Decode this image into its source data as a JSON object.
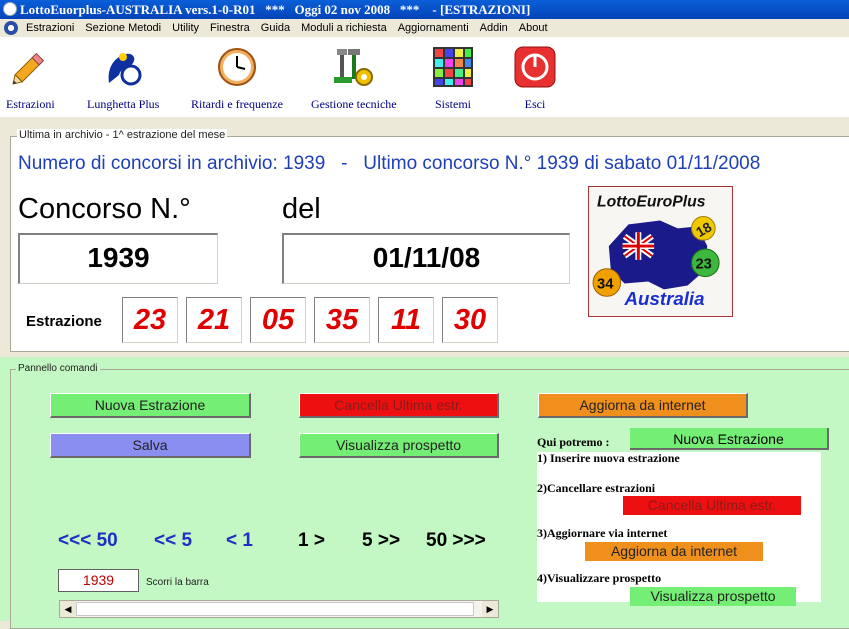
{
  "window": {
    "title": "LottoEuorplus-AUSTRALIA vers.1-0-R01   ***   Oggi 02 nov 2008   ***    - [ESTRAZIONI]"
  },
  "menu": [
    "Estrazioni",
    "Sezione Metodi",
    "Utility",
    "Finestra",
    "Guida",
    "Moduli a richiesta",
    "Aggiornamenti",
    "Addin",
    "About"
  ],
  "toolbar": {
    "estrazioni": "Estrazioni",
    "lunghetta": "Lunghetta Plus",
    "ritardi": "Ritardi e frequenze",
    "tecniche": "Gestione tecniche",
    "sistemi": "Sistemi",
    "esci": "Esci"
  },
  "archive": {
    "legend": "Ultima in archivio - 1^ estrazione del mese",
    "info": "Numero di concorsi in archivio: 1939   -   Ultimo concorso N.° 1939 di sabato 01/11/2008",
    "concorso_label": "Concorso N.°",
    "del_label": "del",
    "concorso_value": "1939",
    "date_value": "01/11/08",
    "estrazione_label": "Estrazione",
    "numbers": [
      "23",
      "21",
      "05",
      "35",
      "11",
      "30"
    ]
  },
  "logo": {
    "line1": "LottoEuroPlus",
    "line2": "Australia",
    "balls": [
      "18",
      "23",
      "34"
    ]
  },
  "panel": {
    "legend": "Pannello comandi",
    "nuova": "Nuova Estrazione",
    "cancella": "Cancella Ultima estr.",
    "aggiorna": "Aggiorna da internet",
    "salva": "Salva",
    "visualizza": "Visualizza prospetto",
    "help_title": "Qui potremo :",
    "help1": "1) Inserire nuova estrazione",
    "help2": "2)Cancellare estrazioni",
    "help3": "3)Aggiornare via internet",
    "help4": "4)Visualizzare prospetto",
    "nav": [
      "<<< 50",
      "<< 5",
      "< 1",
      "1 >",
      "5 >>",
      "50 >>>"
    ],
    "counter": "1939",
    "scroll_label": "Scorri la barra"
  },
  "colors": {
    "accent_blue": "#1f3fb9",
    "number_red": "#e00000",
    "panel_green": "#c3f7c3"
  }
}
